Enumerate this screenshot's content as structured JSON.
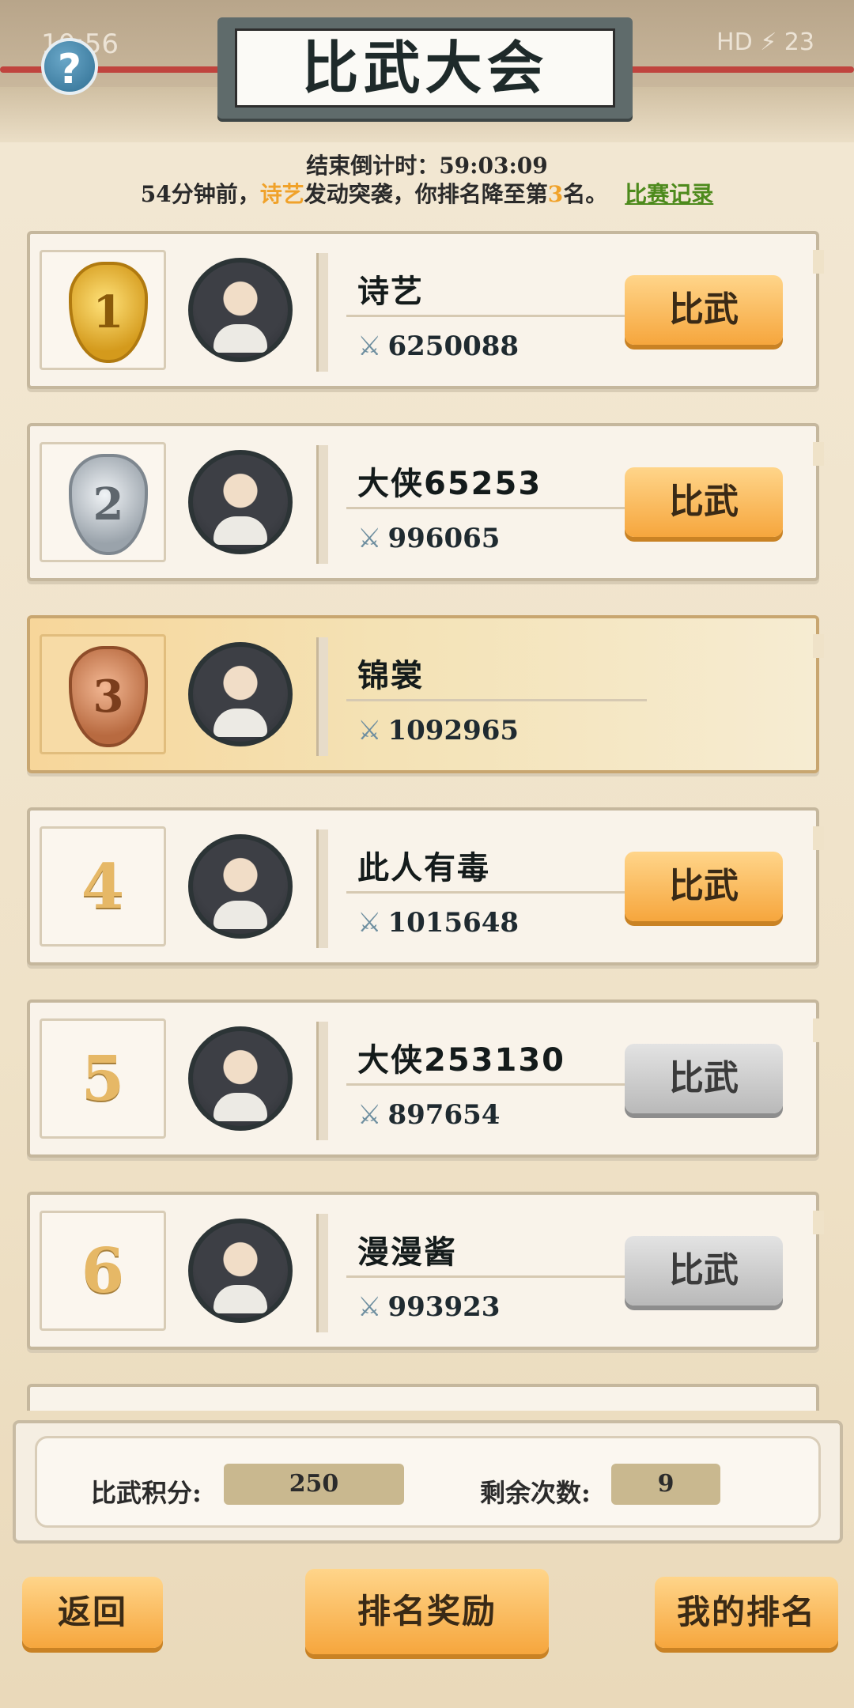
{
  "status_bar": {
    "time": "10:56",
    "right_text": "HD ⚡ 23"
  },
  "title": "比武大会",
  "countdown": "结束倒计时：59:03:09",
  "notice": {
    "prefix": "54分钟前，",
    "attacker": "诗艺",
    "middle": "发动突袭，你排名降至第",
    "rank": "3",
    "suffix": "名。",
    "record_link": "比赛记录"
  },
  "fight_label": "比武",
  "entries": [
    {
      "rank": "1",
      "name": "诗艺",
      "power": "6250088",
      "button": "enabled"
    },
    {
      "rank": "2",
      "name": "大侠65253",
      "power": "996065",
      "button": "enabled"
    },
    {
      "rank": "3",
      "name": "锦裳",
      "power": "1092965",
      "button": "none"
    },
    {
      "rank": "4",
      "name": "此人有毒",
      "power": "1015648",
      "button": "enabled"
    },
    {
      "rank": "5",
      "name": "大侠253130",
      "power": "897654",
      "button": "disabled"
    },
    {
      "rank": "6",
      "name": "漫漫酱",
      "power": "993923",
      "button": "disabled"
    }
  ],
  "stats": {
    "score_label": "比武积分:",
    "score_value": "250",
    "remaining_label": "剩余次数:",
    "remaining_value": "9"
  },
  "buttons": {
    "back": "返回",
    "rank_reward": "排名奖励",
    "my_rank": "我的排名"
  },
  "icons": {
    "help": "?",
    "sword": "⚔"
  },
  "colors": {
    "accent_orange": "#f6a63d",
    "link_green": "#4d8a1c",
    "highlight_yellow": "#f0a22a"
  }
}
